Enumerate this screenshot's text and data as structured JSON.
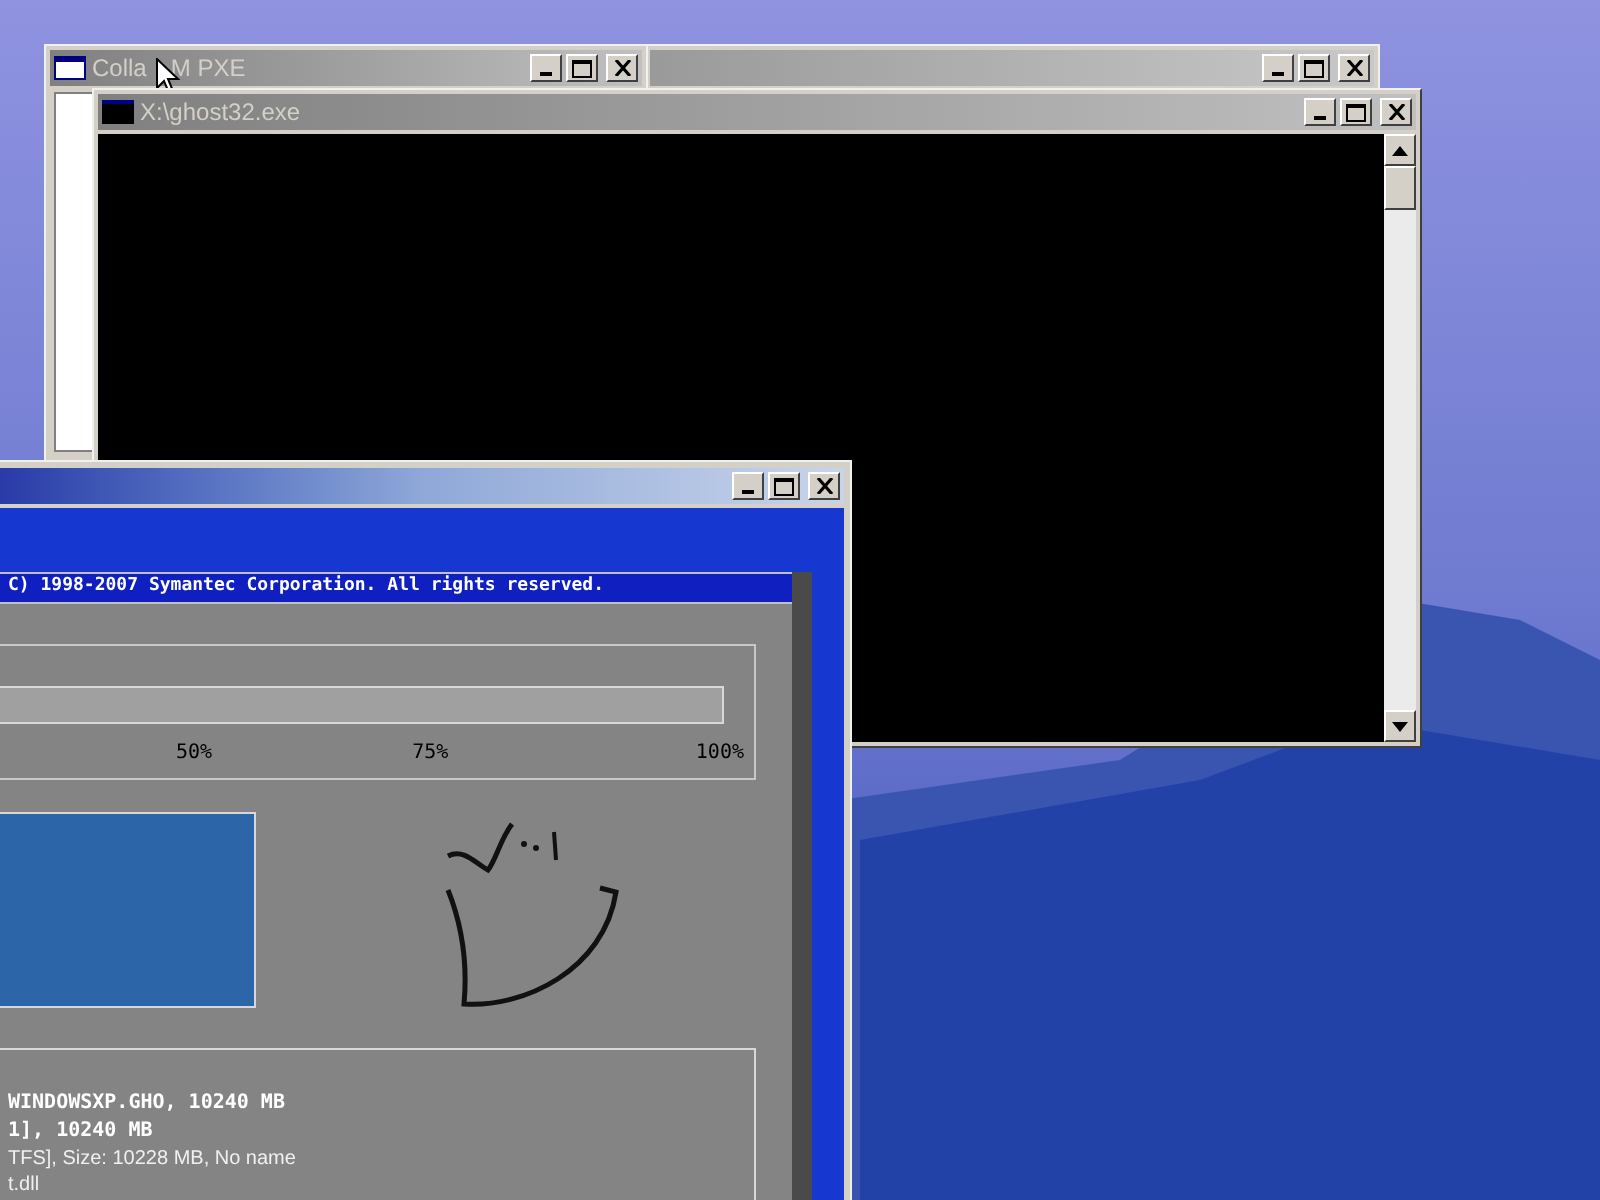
{
  "back_window": {
    "title_start": "Colla",
    "title_end": "M PXE"
  },
  "console_window": {
    "title": "X:\\ghost32.exe"
  },
  "ghost_window": {
    "copyright": "C) 1998-2007 Symantec Corporation. All rights reserved.",
    "progress": {
      "level": 0,
      "ticks": [
        "50%",
        "75%",
        "100%"
      ]
    },
    "details": [
      {
        "text": "WINDOWSXP.GHO, 10240 MB",
        "bold": true
      },
      {
        "text": "1], 10240 MB",
        "bold": true
      },
      {
        "text": "TFS], Size: 10228 MB, No name",
        "bold": false
      },
      {
        "text": "t.dll",
        "bold": false
      }
    ]
  }
}
